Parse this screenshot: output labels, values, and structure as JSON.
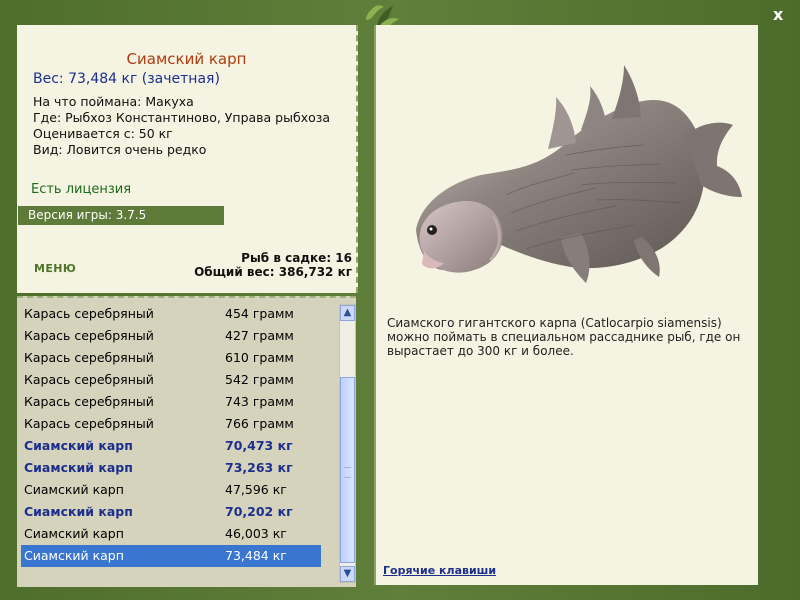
{
  "window": {
    "close_label": "x"
  },
  "fish": {
    "title": "Сиамский карп",
    "weight_text": "Вес: 73,484 кг (зачетная)",
    "caught_on": "На что поймана: Макуха",
    "location": "Где: Рыбхоз Константиново, Управа рыбхоза",
    "rated_from": "Оценивается с: 50 кг",
    "kind": "Вид: Ловится очень редко",
    "license_text": "Есть лицензия",
    "game_version": "Версия игры: 3.7.5"
  },
  "menu": {
    "label": "МЕНЮ"
  },
  "cage": {
    "count_text": "Рыб в садке: 16",
    "total_weight_text": "Общий вес: 386,732 кг"
  },
  "catch_list": [
    {
      "name": "Карась серебряный",
      "weight": "454 грамм",
      "bold": false,
      "selected": false
    },
    {
      "name": "Карась серебряный",
      "weight": "427 грамм",
      "bold": false,
      "selected": false
    },
    {
      "name": "Карась серебряный",
      "weight": "610 грамм",
      "bold": false,
      "selected": false
    },
    {
      "name": "Карась серебряный",
      "weight": "542 грамм",
      "bold": false,
      "selected": false
    },
    {
      "name": "Карась серебряный",
      "weight": "743 грамм",
      "bold": false,
      "selected": false
    },
    {
      "name": "Карась серебряный",
      "weight": "766 грамм",
      "bold": false,
      "selected": false
    },
    {
      "name": "Сиамский карп",
      "weight": "70,473 кг",
      "bold": true,
      "selected": false
    },
    {
      "name": "Сиамский карп",
      "weight": "73,263 кг",
      "bold": true,
      "selected": false
    },
    {
      "name": "Сиамский карп",
      "weight": "47,596 кг",
      "bold": false,
      "selected": false
    },
    {
      "name": "Сиамский карп",
      "weight": "70,202 кг",
      "bold": true,
      "selected": false
    },
    {
      "name": "Сиамский карп",
      "weight": "46,003 кг",
      "bold": false,
      "selected": false
    },
    {
      "name": "Сиамский карп",
      "weight": "73,484 кг",
      "bold": false,
      "selected": true
    }
  ],
  "description": {
    "line1": "Сиамского гигантского карпа (Catlocarpio siamensis)",
    "line2": "можно поймать в специальном рассаднике рыб, где он",
    "line3": "вырастает до 300 кг и более."
  },
  "footer": {
    "hotkeys_label": "Горячие клавиши"
  },
  "icons": {
    "leaf": "leaf-icon",
    "fish": "fish-image"
  }
}
